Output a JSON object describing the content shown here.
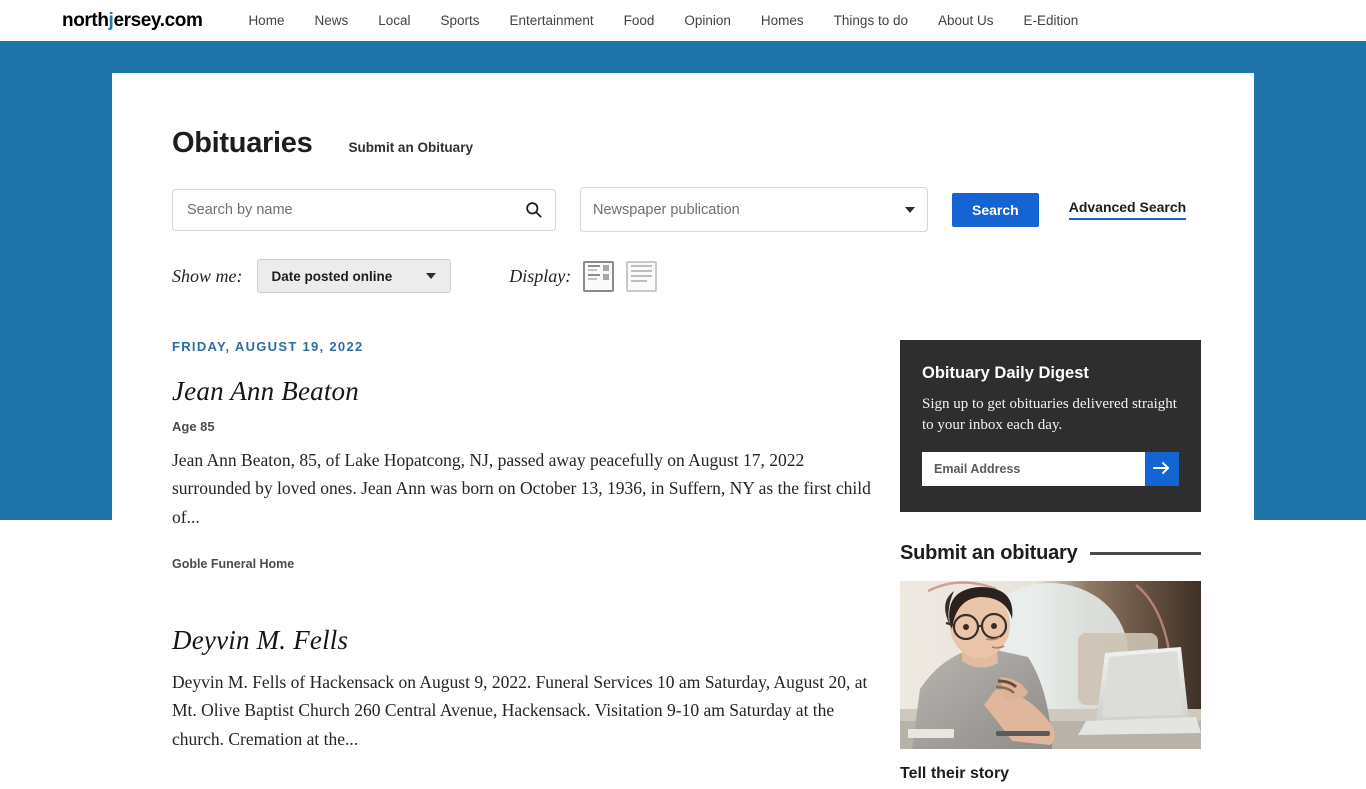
{
  "nav": {
    "brand": "northjersey.com",
    "links": [
      "Home",
      "News",
      "Local",
      "Sports",
      "Entertainment",
      "Food",
      "Opinion",
      "Homes",
      "Things to do",
      "About Us",
      "E-Edition"
    ]
  },
  "header": {
    "title": "Obituaries",
    "submit_link": "Submit an Obituary"
  },
  "search": {
    "name_placeholder": "Search by name",
    "name_value": "",
    "publication_label": "Newspaper publication",
    "search_button": "Search",
    "advanced_link": "Advanced Search",
    "search_icon": "search-icon",
    "dropdown_icon": "chevron-down-icon"
  },
  "filters": {
    "show_me_label": "Show me:",
    "show_me_value": "Date posted online",
    "display_label": "Display:",
    "display_grid_icon": "list-with-thumbnails-icon",
    "display_list_icon": "list-lines-icon",
    "display_selected": "list-with-thumbnails-icon"
  },
  "listing": {
    "date_header": "FRIDAY, AUGUST 19, 2022",
    "obituaries": [
      {
        "name": "Jean Ann Beaton",
        "age": "Age 85",
        "excerpt": "Jean Ann Beaton, 85, of Lake Hopatcong, NJ, passed away peacefully on August 17, 2022 surrounded by loved ones. Jean Ann was born on October 13, 1936, in Suffern, NY as the first child of...",
        "funeral_home": "Goble Funeral Home"
      },
      {
        "name": "Deyvin M. Fells",
        "age": "",
        "excerpt": "Deyvin M. Fells of Hackensack on August 9, 2022. Funeral Services 10 am Saturday, August 20, at Mt. Olive Baptist Church 260 Central Avenue, Hackensack. Visitation 9-10 am Saturday at the church. Cremation at the...",
        "funeral_home": ""
      }
    ]
  },
  "sidebar": {
    "digest": {
      "title": "Obituary Daily Digest",
      "description": "Sign up to get obituaries delivered straight to your inbox each day.",
      "email_placeholder": "Email Address",
      "email_value": "",
      "submit_icon": "arrow-right-icon"
    },
    "submit_section": {
      "heading": "Submit an obituary",
      "photo_alt": "woman-at-laptop-photo",
      "caption": "Tell their story"
    }
  },
  "colors": {
    "band_blue": "#1f74aa",
    "accent_blue": "#1464d4",
    "date_blue": "#2d6ca2",
    "digest_dark": "#2e2e2e"
  }
}
